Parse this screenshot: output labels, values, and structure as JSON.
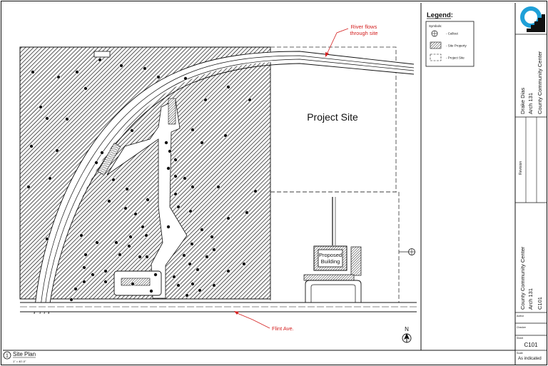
{
  "drawing": {
    "project_site_label": "Project Site",
    "building_label_line1": "Proposed",
    "building_label_line2": "Building",
    "annotation_river_line1": "River flows",
    "annotation_river_line2": "through site",
    "annotation_road": "Flint Ave.",
    "north_label": "N"
  },
  "legend": {
    "title": "Legend:",
    "subtitle": "Symbols:",
    "items": [
      {
        "symbol": "callout-icon",
        "label": "- Callout"
      },
      {
        "symbol": "hatch-swatch-icon",
        "label": "- Site Property"
      },
      {
        "symbol": "dashed-rect-icon",
        "label": "- Project Site"
      }
    ]
  },
  "title_block": {
    "designer": "Drake Dias",
    "course": "Arch 131",
    "project_short": "County Community Center",
    "revision_label": "Revision",
    "project_name": "County Community Center",
    "course2": "Arch 131",
    "sheet_id_vertical": "C101",
    "author_label": "Author",
    "checker_label": "Checker",
    "sheet_label": "Sheet",
    "sheet_number": "C101",
    "scale_label": "Scale",
    "scale_value": "As indicated"
  },
  "view": {
    "number": "1",
    "title": "Site Plan",
    "scale": "1\" = 40'-0\""
  },
  "colors": {
    "line": "#111111",
    "annotation": "#d42020",
    "logo": "#1fa0d8"
  }
}
